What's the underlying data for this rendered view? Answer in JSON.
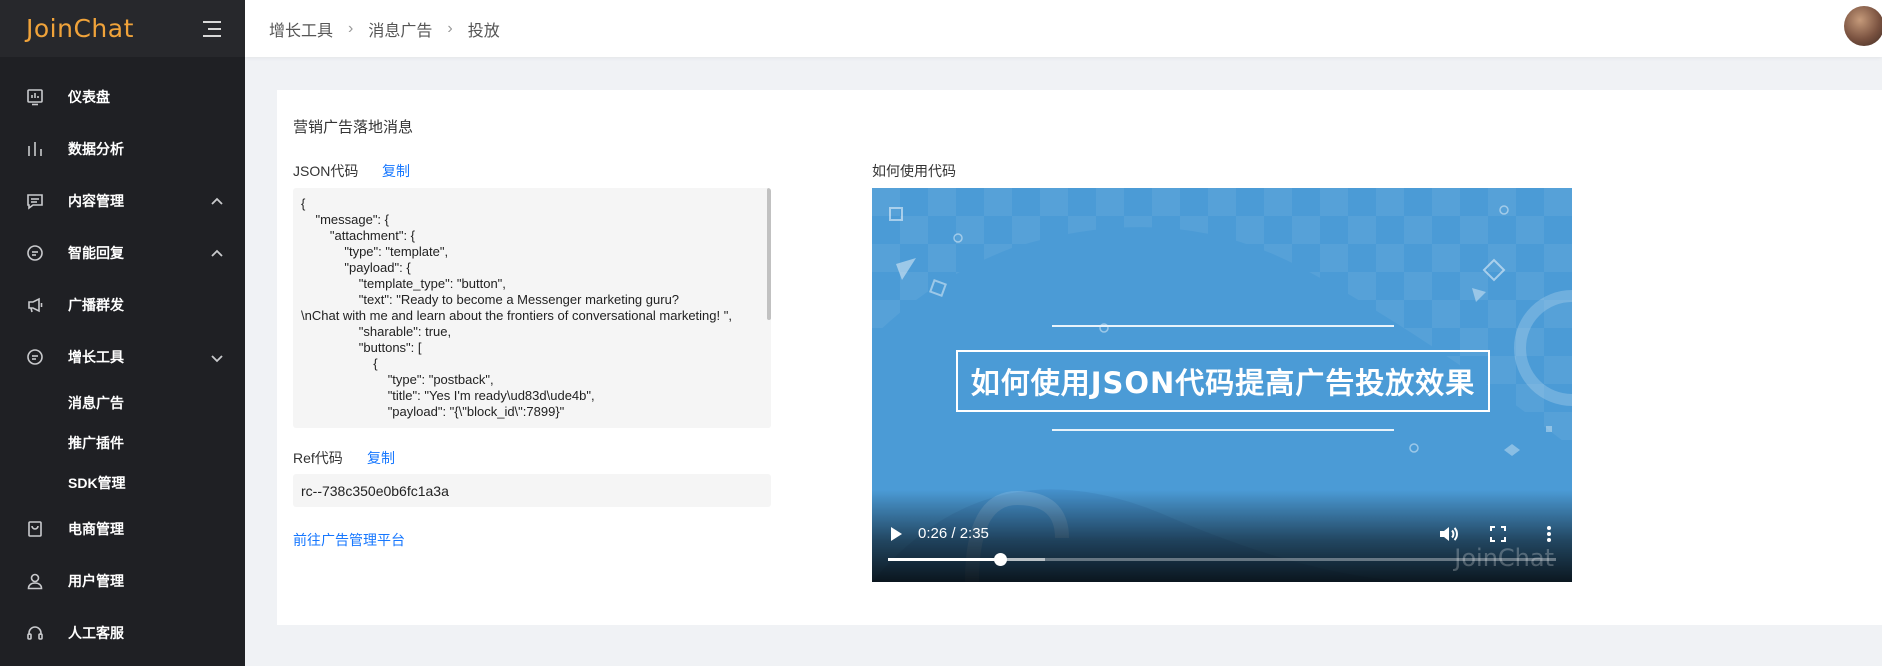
{
  "app": {
    "logo": "JoinChat"
  },
  "sidebar": {
    "items": [
      {
        "label": "仪表盘",
        "icon": "dashboard-icon"
      },
      {
        "label": "数据分析",
        "icon": "bar-chart-icon"
      },
      {
        "label": "内容管理",
        "icon": "message-icon",
        "chevron": "up"
      },
      {
        "label": "智能回复",
        "icon": "chat-bot-icon",
        "chevron": "up"
      },
      {
        "label": "广播群发",
        "icon": "broadcast-icon"
      },
      {
        "label": "增长工具",
        "icon": "growth-icon",
        "chevron": "down"
      },
      {
        "label": "电商管理",
        "icon": "shopping-bag-icon"
      },
      {
        "label": "用户管理",
        "icon": "user-icon"
      },
      {
        "label": "人工客服",
        "icon": "headset-icon"
      }
    ],
    "growth_submenu": [
      "消息广告",
      "推广插件",
      "SDK管理"
    ]
  },
  "breadcrumb": [
    "增长工具",
    "消息广告",
    "投放"
  ],
  "main": {
    "title": "营销广告落地消息",
    "json_label": "JSON代码",
    "copy_label": "复制",
    "json_code": "{\n    \"message\": {\n        \"attachment\": {\n            \"type\": \"template\",\n            \"payload\": {\n                \"template_type\": \"button\",\n                \"text\": \"Ready to become a Messenger marketing guru?\n\\nChat with me and learn about the frontiers of conversational marketing! \",\n                \"sharable\": true,\n                \"buttons\": [\n                    {\n                        \"type\": \"postback\",\n                        \"title\": \"Yes I'm ready\\ud83d\\ude4b\",\n                        \"payload\": \"{\\\"block_id\\\":7899}\"",
    "ref_label": "Ref代码",
    "ref_copy_label": "复制",
    "ref_value": "rc--738c350e0b6fc1a3a",
    "platform_link": "前往广告管理平台",
    "video_label": "如何使用代码"
  },
  "video": {
    "title": "如何使用JSON代码提高广告投放效果",
    "time": "0:26 / 2:35",
    "progress": 0.168,
    "buffered": 0.235,
    "watermark": "JoinChat",
    "bg_color": "#4b9bd6"
  },
  "colors": {
    "link": "#1677ff",
    "sidebar_bg": "#1f2024",
    "logo": "#f0a33a"
  }
}
